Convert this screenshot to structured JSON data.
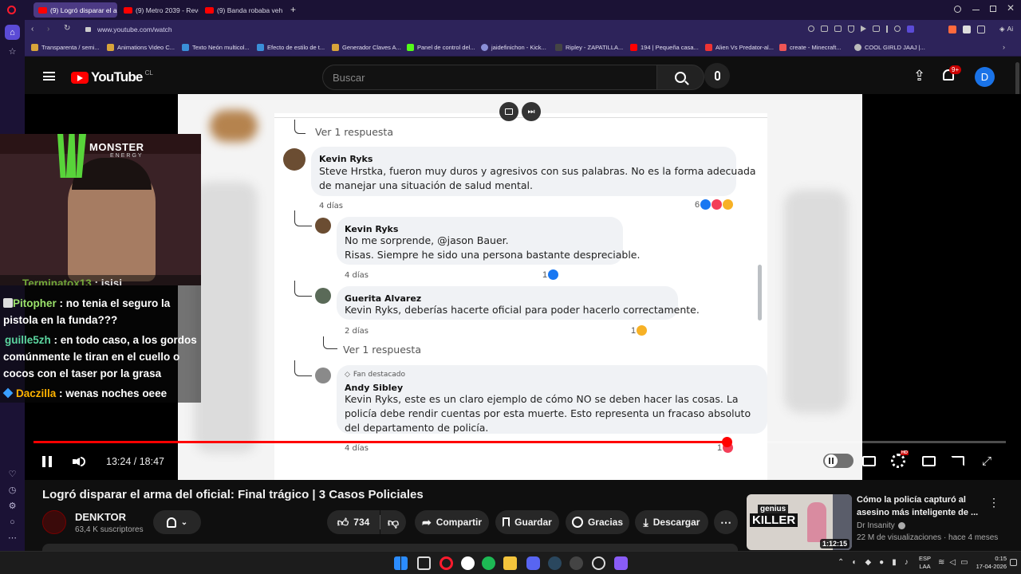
{
  "browser": {
    "tabs": [
      {
        "label": "(9) Logró disparar el ar",
        "active": true
      },
      {
        "label": "(9) Metro 2039 - Reveal Tr",
        "active": false
      },
      {
        "label": "(9) Banda robaba vehículo",
        "active": false
      }
    ],
    "new_tab_symbol": "+",
    "url": "www.youtube.com/watch",
    "ai_label": "Ai",
    "bookmarks": [
      "Transparenta / semi...",
      "Animations Video C...",
      "Texto Neón multicol...",
      "Efecto de estilo de t...",
      "Generador Claves A...",
      "Panel de control del...",
      "jaidefinichon - Kick...",
      "Ripley - ZAPATILLA...",
      "194 | Pequeña casa...",
      "Alien Vs Predator-al...",
      "create - Minecraft...",
      "COOL GIRLD JAAJ |..."
    ]
  },
  "youtube": {
    "logo_text": "YouTube",
    "region": "CL",
    "search_placeholder": "Buscar",
    "notif_count": "9+",
    "avatar_letter": "D"
  },
  "video_content": {
    "comments": [
      {
        "view_replies": "Ver 1 respuesta"
      },
      {
        "name": "Kevin Ryks",
        "text1": "Steve Hrstka, fueron muy duros y agresivos con sus palabras. No es la forma adecuada",
        "text2": "de manejar una situación de salud mental.",
        "time": "4 días",
        "reactions": "6"
      },
      {
        "name": "Kevin Ryks",
        "text1": "No me sorprende, @jason Bauer.",
        "text2": "Risas. Siempre he sido una persona bastante despreciable.",
        "time": "4 días",
        "reactions": "1"
      },
      {
        "name": "Guerita Alvarez",
        "text1": "Kevin Ryks, deberías hacerte oficial para poder hacerlo correctamente.",
        "time": "2 días",
        "reactions": "1",
        "view_replies": "Ver 1 respuesta"
      },
      {
        "badge": "Fan destacado",
        "name": "Andy Sibley",
        "text1": "Kevin Ryks, este es un claro ejemplo de cómo NO se deben hacer las cosas. La",
        "text2": "policía debe rendir cuentas por esta muerte. Esto representa un fracaso absoluto",
        "text3": "del departamento de policía.",
        "time": "4 días",
        "reactions": "1"
      }
    ]
  },
  "stream_overlay": {
    "sponsor": "MONSTER",
    "sponsor_sub": "ENERGY",
    "chat": [
      {
        "user": "Terminatox13",
        "msg": " : jsjsj",
        "color": "#7fbf3f"
      },
      {
        "user": "Pitopher",
        "msg": " : no tenia el seguro la pistola en la funda???",
        "color": "#9be26b"
      },
      {
        "user": "guille5zh",
        "msg": " : en todo caso, a los gordos comúnmente le tiran en el cuello o cocos con el taser por la grasa",
        "color": "#5cd6a0"
      },
      {
        "user": "Daczilla",
        "msg": " : wenas noches oeee",
        "color": "#ffb300"
      }
    ]
  },
  "player": {
    "time_current": "13:24",
    "time_total": "18:47",
    "time_separator": " / ",
    "progress": 0.713,
    "buffered": 0.75,
    "hd_badge": "HD"
  },
  "video": {
    "title": "Logró disparar el arma del oficial: Final trágico | 3 Casos Policiales",
    "channel": "DENKTOR",
    "subscribers": "63,4 K suscriptores",
    "likes": "734",
    "share": "Compartir",
    "save": "Guardar",
    "thanks": "Gracias",
    "download": "Descargar"
  },
  "recommended": {
    "title_line1": "Cómo la policía capturó al",
    "title_line2": "asesino más inteligente de ...",
    "channel": "Dr Insanity",
    "stats": "22 M de visualizaciones · hace 4 meses",
    "duration": "1:12:15",
    "thumb_text1": "genius",
    "thumb_text2": "KILLER"
  },
  "taskbar": {
    "lang1": "ESP",
    "lang2": "LAA",
    "time": "0:15",
    "date": "17-04-2026"
  }
}
